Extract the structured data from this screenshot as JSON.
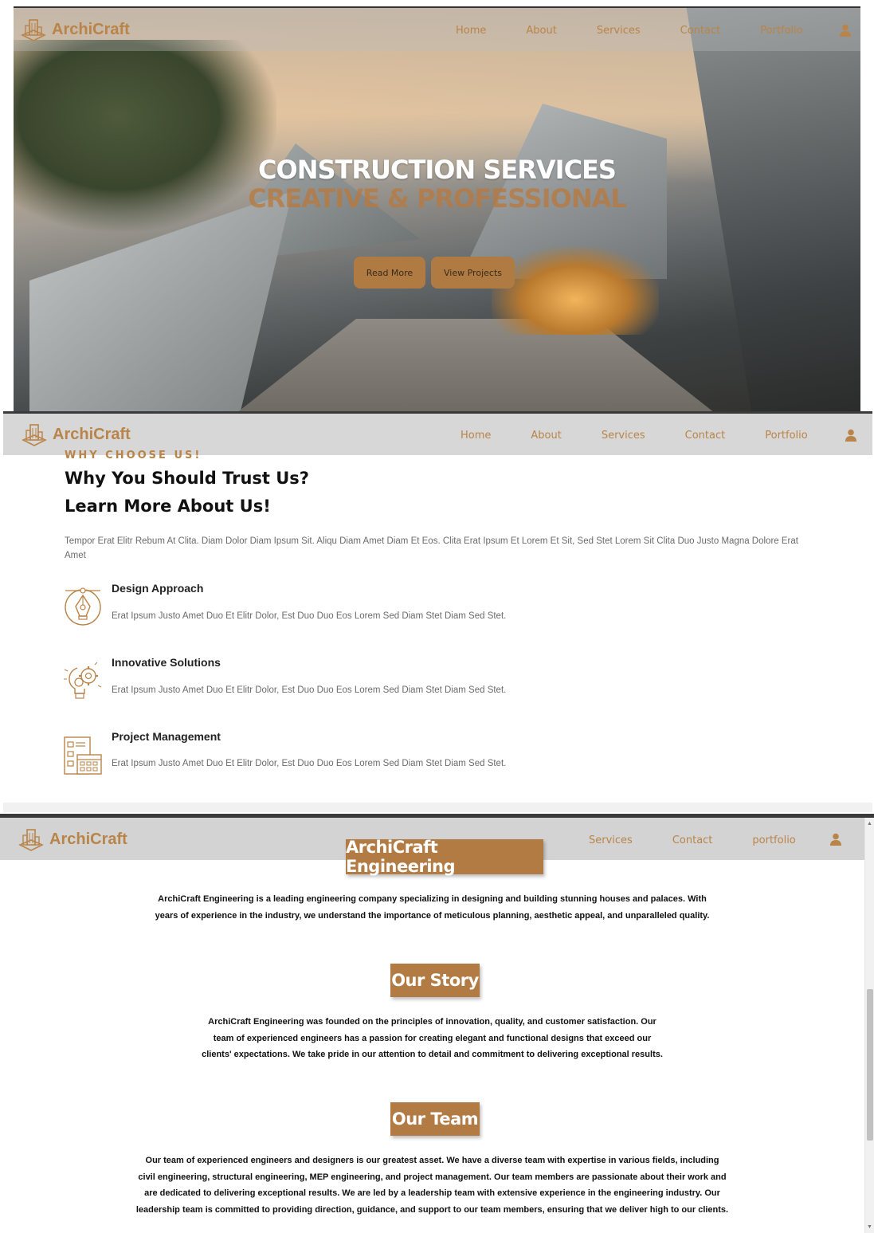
{
  "brand": {
    "name": "ArchiCraft",
    "logo_icon": "building-logo-icon"
  },
  "colors": {
    "accent": "#b98449",
    "button": "#b07a43",
    "tag_bg": "#b37b44"
  },
  "hero": {
    "nav": {
      "items": [
        "Home",
        "About",
        "Services",
        "Contact",
        "Portfolio"
      ],
      "user_icon": "user-icon"
    },
    "title": "CONSTRUCTION SERVICES",
    "subtitle": "CREATIVE & PROFESSIONAL",
    "buttons": {
      "read_more": "Read More",
      "view_projects": "View Projects"
    }
  },
  "why": {
    "nav": {
      "items": [
        "Home",
        "About",
        "Services",
        "Contact",
        "Portfolio"
      ]
    },
    "eyebrow": "WHY CHOOSE US!",
    "heading1": "Why You Should Trust Us?",
    "heading2": "Learn More About Us!",
    "lead": "Tempor Erat Elitr Rebum At Clita. Diam Dolor Diam Ipsum Sit. Aliqu Diam Amet Diam Et Eos. Clita Erat Ipsum Et Lorem Et Sit, Sed Stet Lorem Sit Clita Duo Justo Magna Dolore Erat Amet",
    "features": [
      {
        "title": "Design Approach",
        "text": "Erat Ipsum Justo Amet Duo Et Elitr Dolor, Est Duo Duo Eos Lorem Sed Diam Stet Diam Sed Stet.",
        "icon": "pen-tool-icon"
      },
      {
        "title": "Innovative Solutions",
        "text": "Erat Ipsum Justo Amet Duo Et Elitr Dolor, Est Duo Duo Eos Lorem Sed Diam Stet Diam Sed Stet.",
        "icon": "gear-bulb-icon"
      },
      {
        "title": "Project Management",
        "text": "Erat Ipsum Justo Amet Duo Et Elitr Dolor, Est Duo Duo Eos Lorem Sed Diam Stet Diam Sed Stet.",
        "icon": "checklist-calendar-icon"
      }
    ]
  },
  "about": {
    "nav": {
      "items": [
        "Services",
        "Contact",
        "portfolio"
      ]
    },
    "tag_main": "ArchiCraft Engineering",
    "intro": [
      "ArchiCraft Engineering is a leading engineering company specializing in designing and building stunning houses and palaces. With",
      "years of experience in the industry, we understand the importance of meticulous planning, aesthetic appeal, and unparalleled quality."
    ],
    "story_tag": "Our Story",
    "story": [
      "ArchiCraft Engineering was founded on the principles of innovation, quality, and customer satisfaction. Our",
      "team of experienced engineers has a passion for creating elegant and functional designs that exceed our",
      "clients' expectations. We take pride in our attention to detail and commitment to delivering exceptional results."
    ],
    "team_tag": "Our Team",
    "team": [
      "Our team of experienced engineers and designers is our greatest asset. We have a diverse team with expertise in various fields, including",
      "civil engineering, structural engineering, MEP engineering, and project management. Our team members are passionate about their work and",
      "are dedicated to delivering exceptional results. We are led by a leadership team with extensive experience in the engineering industry. Our",
      "leadership team is committed to providing direction, guidance, and support to our team members, ensuring that we deliver high to our clients."
    ]
  }
}
